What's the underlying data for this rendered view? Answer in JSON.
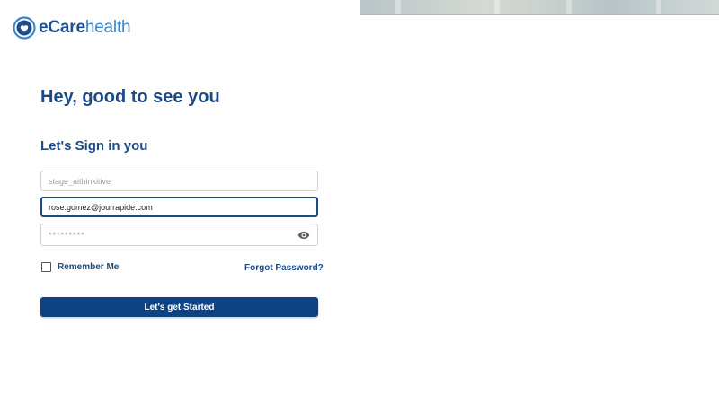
{
  "brand": {
    "name_strong": "eCare",
    "name_light": "health",
    "primary_color": "#1b4a86",
    "accent_color": "#3a86c8"
  },
  "login": {
    "greeting": "Hey, good to see you",
    "subheading": "Let's Sign in you",
    "username": {
      "value": "",
      "placeholder": "stage_aithinkitive"
    },
    "email": {
      "value": "rose.gomez@jourrapide.com",
      "placeholder": ""
    },
    "password": {
      "value": "",
      "placeholder": "*********",
      "toggle_icon": "eye-icon"
    },
    "remember_label": "Remember Me",
    "remember_checked": false,
    "forgot_label": "Forgot Password?",
    "submit_label": "Let's get Started"
  }
}
